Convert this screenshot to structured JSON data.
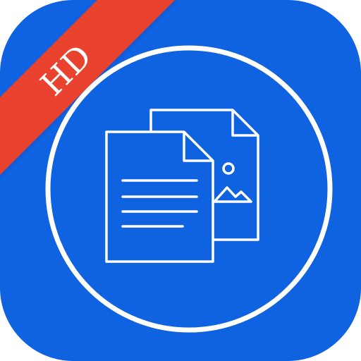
{
  "badge": {
    "label": "HD",
    "color": "#e9432f"
  },
  "icon": {
    "background_color": "#0f62e0",
    "foreground_color": "#ffffff",
    "symbols": [
      "document-text-icon",
      "image-file-icon"
    ]
  }
}
